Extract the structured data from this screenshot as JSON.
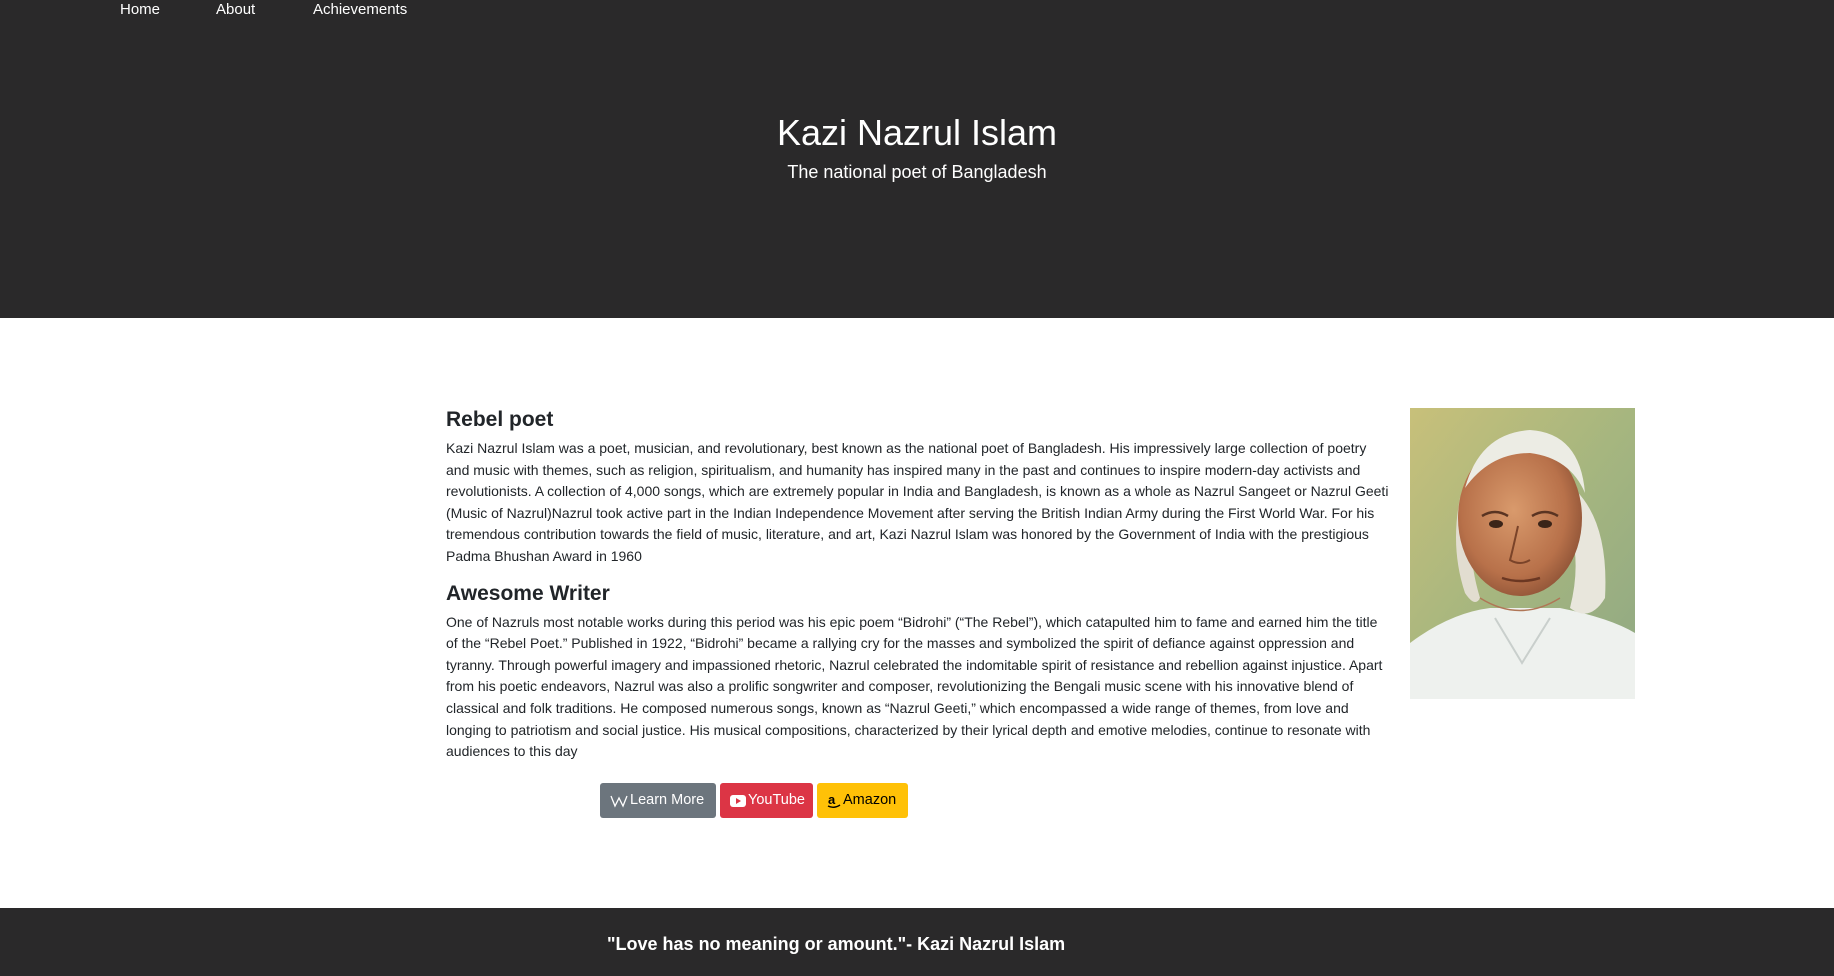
{
  "nav": {
    "home": "Home",
    "about": "About",
    "achievements": "Achievements"
  },
  "hero": {
    "title": "Kazi Nazrul Islam",
    "subtitle": "The national poet of Bangladesh"
  },
  "sections": [
    {
      "title": "Rebel poet",
      "body": "Kazi Nazrul Islam was a poet, musician, and revolutionary, best known as the national poet of Bangladesh. His impressively large collection of poetry and music with themes, such as religion, spiritualism, and humanity has inspired many in the past and continues to inspire modern-day activists and revolutionists. A collection of 4,000 songs, which are extremely popular in India and Bangladesh, is known as a whole as Nazrul Sangeet or Nazrul Geeti (Music of Nazrul)Nazrul took active part in the Indian Independence Movement after serving the British Indian Army during the First World War. For his tremendous contribution towards the field of music, literature, and art, Kazi Nazrul Islam was honored by the Government of India with the prestigious Padma Bhushan Award in 1960"
    },
    {
      "title": "Awesome Writer",
      "body": "One of Nazruls most notable works during this period was his epic poem “Bidrohi” (“The Rebel”), which catapulted him to fame and earned him the title of the “Rebel Poet.” Published in 1922, “Bidrohi” became a rallying cry for the masses and symbolized the spirit of defiance against oppression and tyranny. Through powerful imagery and impassioned rhetoric, Nazrul celebrated the indomitable spirit of resistance and rebellion against injustice. Apart from his poetic endeavors, Nazrul was also a prolific songwriter and composer, revolutionizing the Bengali music scene with his innovative blend of classical and folk traditions. He composed numerous songs, known as “Nazrul Geeti,” which encompassed a wide range of themes, from love and longing to patriotism and social justice. His musical compositions, characterized by their lyrical depth and emotive melodies, continue to resonate with audiences to this day"
    }
  ],
  "buttons": {
    "learn_more": {
      "label": "Learn More",
      "icon": "wikipedia-icon",
      "color": "#6c757d"
    },
    "youtube": {
      "label": "YouTube",
      "icon": "youtube-icon",
      "color": "#dc3545"
    },
    "amazon": {
      "label": "Amazon",
      "icon": "amazon-icon",
      "color": "#ffc107"
    }
  },
  "footer": {
    "quote": "\"Love has no meaning or amount.\"- Kazi Nazrul Islam"
  },
  "colors": {
    "dark_band": "#2a292a",
    "text": "#212529"
  }
}
